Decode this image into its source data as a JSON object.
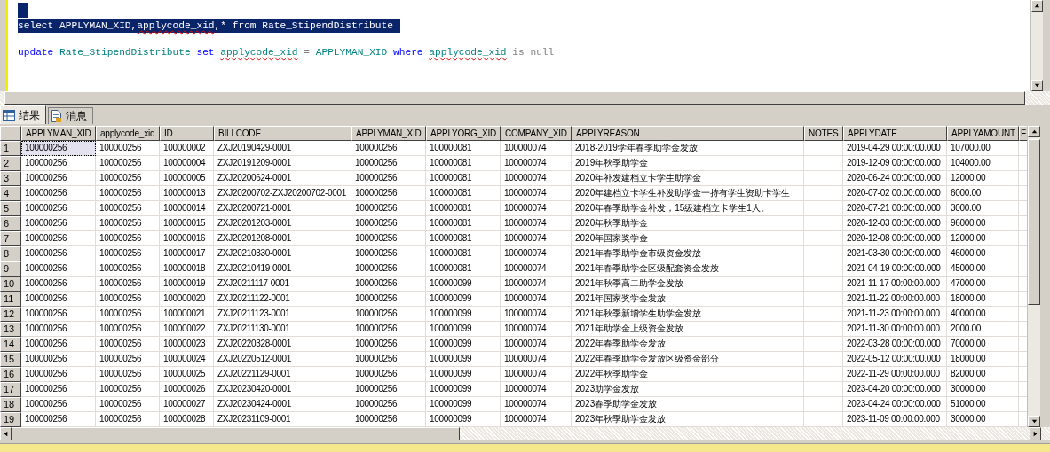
{
  "editor": {
    "lines": [
      {
        "selected": true,
        "blank_before": false
      },
      {
        "selected": true,
        "blank_before": false,
        "tokens": [
          {
            "text": "select APPLYMAN_XID,",
            "kind": "plain"
          },
          {
            "text": "applycode_xid",
            "kind": "plain",
            "squiggle": true
          },
          {
            "text": ",* from Rate_StipendDistribute",
            "kind": "plain"
          }
        ]
      },
      {
        "selected": false,
        "blank_before": true,
        "tokens": [
          {
            "text": "update ",
            "kind": "keyword"
          },
          {
            "text": "Rate_StipendDistribute ",
            "kind": "identifier"
          },
          {
            "text": "set ",
            "kind": "keyword"
          },
          {
            "text": "applycode_xid",
            "kind": "identifier",
            "squiggle": true
          },
          {
            "text": " = ",
            "kind": "operator"
          },
          {
            "text": "APPLYMAN_XID ",
            "kind": "identifier"
          },
          {
            "text": "where ",
            "kind": "keyword"
          },
          {
            "text": "applycode_xid",
            "kind": "identifier",
            "squiggle": true
          },
          {
            "text": " is null",
            "kind": "operator"
          }
        ]
      }
    ]
  },
  "tabs": [
    {
      "label": "结果",
      "selected": true
    },
    {
      "label": "消息",
      "selected": false
    }
  ],
  "grid": {
    "columns": [
      "APPLYMAN_XID",
      "applycode_xid",
      "ID",
      "BILLCODE",
      "APPLYMAN_XID",
      "APPLYORG_XID",
      "COMPANY_XID",
      "APPLYREASON",
      "NOTES",
      "APPLYDATE",
      "APPLYAMOUNT",
      "F"
    ],
    "rows": [
      {
        "number": "1",
        "selected": true,
        "cells": [
          "100000256",
          "100000256",
          "100000002",
          "ZXJ20190429-0001",
          "100000256",
          "100000081",
          "100000074",
          "2018-2019学年春季助学金发放",
          "",
          "2019-04-29 00:00:00.000",
          "107000.00"
        ]
      },
      {
        "number": "2",
        "selected": false,
        "cells": [
          "100000256",
          "100000256",
          "100000004",
          "ZXJ20191209-0001",
          "100000256",
          "100000081",
          "100000074",
          "2019年秋季助学金",
          "",
          "2019-12-09 00:00:00.000",
          "104000.00"
        ]
      },
      {
        "number": "3",
        "selected": false,
        "cells": [
          "100000256",
          "100000256",
          "100000005",
          "ZXJ20200624-0001",
          "100000256",
          "100000081",
          "100000074",
          "2020年补发建档立卡学生助学金",
          "",
          "2020-06-24 00:00:00.000",
          "12000.00"
        ]
      },
      {
        "number": "4",
        "selected": false,
        "cells": [
          "100000256",
          "100000256",
          "100000013",
          "ZXJ20200702-ZXJ20200702-0001",
          "100000256",
          "100000081",
          "100000074",
          "2020年建档立卡学生补发助学金一持有学生资助卡学生",
          "",
          "2020-07-02 00:00:00.000",
          "6000.00"
        ]
      },
      {
        "number": "5",
        "selected": false,
        "cells": [
          "100000256",
          "100000256",
          "100000014",
          "ZXJ20200721-0001",
          "100000256",
          "100000081",
          "100000074",
          "2020年春季助学金补发，15级建档立卡学生1人。",
          "",
          "2020-07-21 00:00:00.000",
          "3000.00"
        ]
      },
      {
        "number": "6",
        "selected": false,
        "cells": [
          "100000256",
          "100000256",
          "100000015",
          "ZXJ20201203-0001",
          "100000256",
          "100000081",
          "100000074",
          "2020年秋季助学金",
          "",
          "2020-12-03 00:00:00.000",
          "96000.00"
        ]
      },
      {
        "number": "7",
        "selected": false,
        "cells": [
          "100000256",
          "100000256",
          "100000016",
          "ZXJ20201208-0001",
          "100000256",
          "100000081",
          "100000074",
          "2020年国家奖学金",
          "",
          "2020-12-08 00:00:00.000",
          "12000.00"
        ]
      },
      {
        "number": "8",
        "selected": false,
        "cells": [
          "100000256",
          "100000256",
          "100000017",
          "ZXJ20210330-0001",
          "100000256",
          "100000081",
          "100000074",
          "2021年春季助学金市级资金发放",
          "",
          "2021-03-30 00:00:00.000",
          "46000.00"
        ]
      },
      {
        "number": "9",
        "selected": false,
        "cells": [
          "100000256",
          "100000256",
          "100000018",
          "ZXJ20210419-0001",
          "100000256",
          "100000081",
          "100000074",
          "2021年春季助学金区级配套资金发放",
          "",
          "2021-04-19 00:00:00.000",
          "45000.00"
        ]
      },
      {
        "number": "10",
        "selected": false,
        "cells": [
          "100000256",
          "100000256",
          "100000019",
          "ZXJ20211117-0001",
          "100000256",
          "100000099",
          "100000074",
          "2021年秋季高二助学金发放",
          "",
          "2021-11-17 00:00:00.000",
          "47000.00"
        ]
      },
      {
        "number": "11",
        "selected": false,
        "cells": [
          "100000256",
          "100000256",
          "100000020",
          "ZXJ20211122-0001",
          "100000256",
          "100000099",
          "100000074",
          "2021年国家奖学金发放",
          "",
          "2021-11-22 00:00:00.000",
          "18000.00"
        ]
      },
      {
        "number": "12",
        "selected": false,
        "cells": [
          "100000256",
          "100000256",
          "100000021",
          "ZXJ20211123-0001",
          "100000256",
          "100000099",
          "100000074",
          "2021年秋季新增学生助学金发放",
          "",
          "2021-11-23 00:00:00.000",
          "40000.00"
        ]
      },
      {
        "number": "13",
        "selected": false,
        "cells": [
          "100000256",
          "100000256",
          "100000022",
          "ZXJ20211130-0001",
          "100000256",
          "100000099",
          "100000074",
          "2021年助学金上级资金发放",
          "",
          "2021-11-30 00:00:00.000",
          "2000.00"
        ]
      },
      {
        "number": "14",
        "selected": false,
        "cells": [
          "100000256",
          "100000256",
          "100000023",
          "ZXJ20220328-0001",
          "100000256",
          "100000099",
          "100000074",
          "2022年春季助学金发放",
          "",
          "2022-03-28 00:00:00.000",
          "70000.00"
        ]
      },
      {
        "number": "15",
        "selected": false,
        "cells": [
          "100000256",
          "100000256",
          "100000024",
          "ZXJ20220512-0001",
          "100000256",
          "100000099",
          "100000074",
          "2022年春季助学金发放区级资金部分",
          "",
          "2022-05-12 00:00:00.000",
          "18000.00"
        ]
      },
      {
        "number": "16",
        "selected": false,
        "cells": [
          "100000256",
          "100000256",
          "100000025",
          "ZXJ20221129-0001",
          "100000256",
          "100000099",
          "100000074",
          "2022年秋季助学金",
          "",
          "2022-11-29 00:00:00.000",
          "82000.00"
        ]
      },
      {
        "number": "17",
        "selected": false,
        "cells": [
          "100000256",
          "100000256",
          "100000026",
          "ZXJ20230420-0001",
          "100000256",
          "100000099",
          "100000074",
          "2023助学金发放",
          "",
          "2023-04-20 00:00:00.000",
          "30000.00"
        ]
      },
      {
        "number": "18",
        "selected": false,
        "cells": [
          "100000256",
          "100000256",
          "100000027",
          "ZXJ20230424-0001",
          "100000256",
          "100000099",
          "100000074",
          "2023春季助学金发放",
          "",
          "2023-04-24 00:00:00.000",
          "51000.00"
        ]
      },
      {
        "number": "19",
        "selected": false,
        "cells": [
          "100000256",
          "100000256",
          "100000028",
          "ZXJ20231109-0001",
          "100000256",
          "100000099",
          "100000074",
          "2023年秋季助学金发放",
          "",
          "2023-11-09 00:00:00.000",
          "30000.00"
        ]
      }
    ]
  }
}
